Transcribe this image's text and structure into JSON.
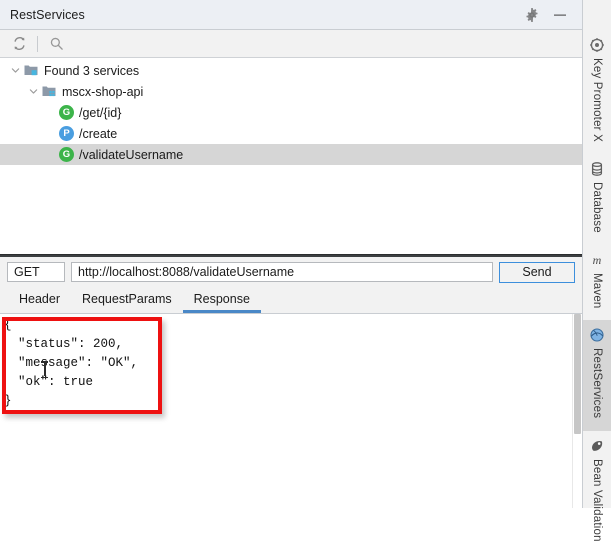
{
  "window": {
    "title": "RestServices",
    "settings_icon": "gear-icon",
    "minimize_icon": "minimize-icon"
  },
  "toolbar": {
    "refresh_icon": "refresh-icon",
    "search_icon": "search-icon"
  },
  "tree": {
    "nodes": [
      {
        "label": "Found 3 services",
        "icon": "folder-module-icon",
        "expanded": true,
        "depth": 0,
        "selected": false,
        "type": "folder"
      },
      {
        "label": "mscx-shop-api",
        "icon": "folder-module-icon",
        "expanded": true,
        "depth": 1,
        "selected": false,
        "type": "folder"
      },
      {
        "label": "/get/{id}",
        "icon": "method-badge",
        "badge": "G",
        "badge_color": "#3cb44a",
        "depth": 2,
        "selected": false,
        "type": "endpoint"
      },
      {
        "label": "/create",
        "icon": "method-badge",
        "badge": "P",
        "badge_color": "#4a9ee0",
        "depth": 2,
        "selected": false,
        "type": "endpoint"
      },
      {
        "label": "/validateUsername",
        "icon": "method-badge",
        "badge": "G",
        "badge_color": "#3cb44a",
        "depth": 2,
        "selected": true,
        "type": "endpoint"
      }
    ]
  },
  "request": {
    "method": "GET",
    "url": "http://localhost:8088/validateUsername",
    "send_label": "Send"
  },
  "tabs": [
    {
      "label": "Header",
      "active": false
    },
    {
      "label": "RequestParams",
      "active": false
    },
    {
      "label": "Response",
      "active": true
    }
  ],
  "response": {
    "lines": [
      {
        "text": "{",
        "indent": false
      },
      {
        "text": "\"status\": 200,",
        "indent": true
      },
      {
        "text": "\"message\": \"OK\",",
        "indent": true
      },
      {
        "text": "\"ok\": true",
        "indent": true
      },
      {
        "text": "}",
        "indent": false
      }
    ]
  },
  "stripe": {
    "tabs": [
      {
        "label": "Key Promoter X",
        "icon": "key-promoter-icon",
        "active": false
      },
      {
        "label": "Database",
        "icon": "database-icon",
        "active": false
      },
      {
        "label": "Maven",
        "icon": "maven-icon",
        "active": false
      },
      {
        "label": "RestServices",
        "icon": "rest-services-icon",
        "active": true
      },
      {
        "label": "Bean Validation",
        "icon": "bean-validation-icon",
        "active": false
      }
    ]
  },
  "colors": {
    "accent_blue": "#4a88c7",
    "annotation_red": "#ee1111",
    "get_green": "#3cb44a",
    "post_blue": "#4a9ee0"
  }
}
